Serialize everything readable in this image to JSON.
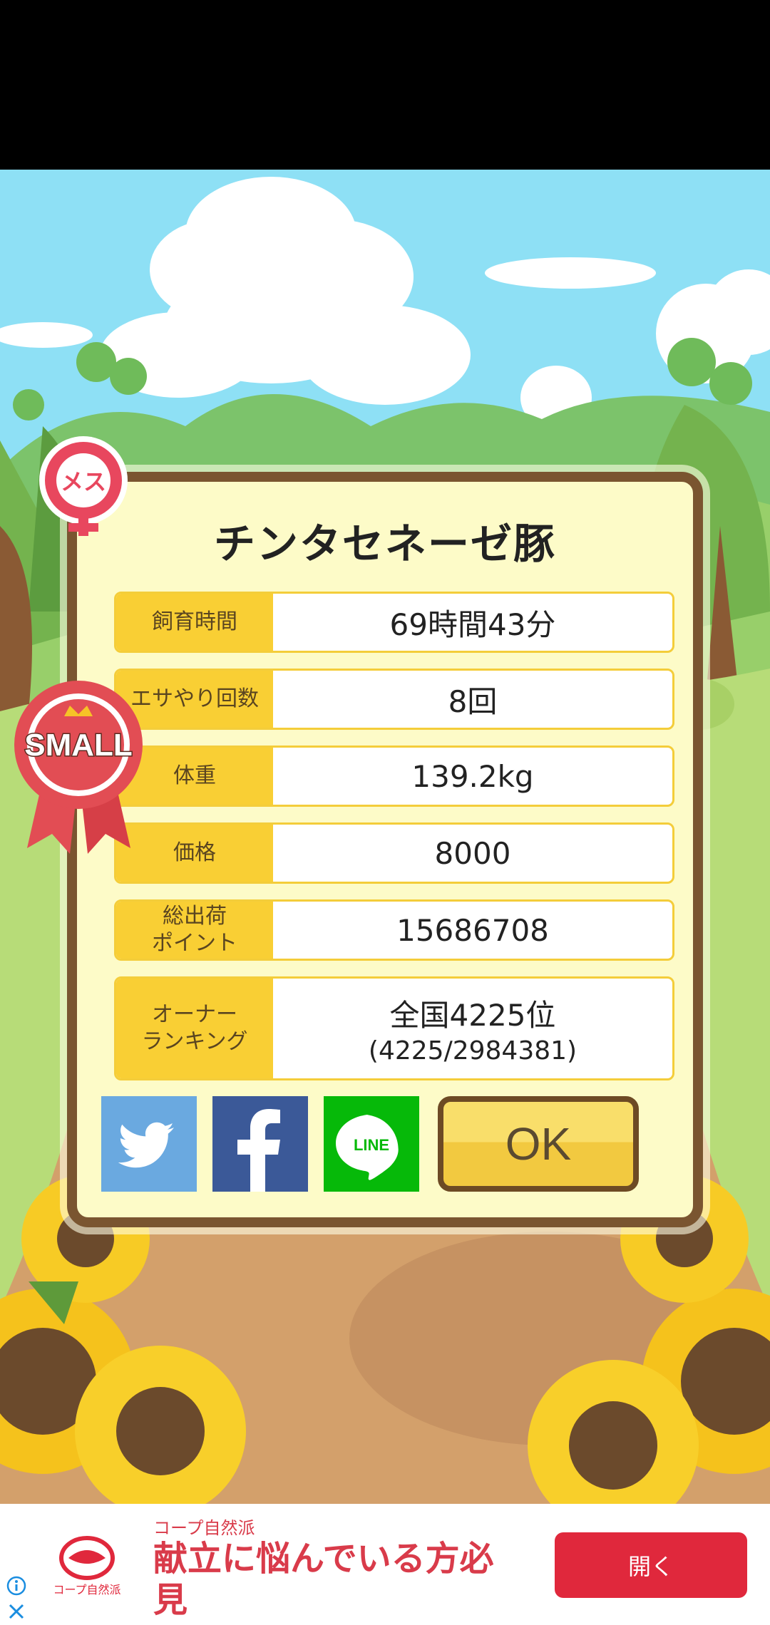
{
  "pig": {
    "name": "チンタセネーゼ豚",
    "gender_badge": "メス",
    "size_ribbon": "SMALL"
  },
  "stats": [
    {
      "label": "飼育時間",
      "value": "69時間43分"
    },
    {
      "label": "エサやり回数",
      "value": "8回"
    },
    {
      "label": "体重",
      "value": "139.2kg"
    },
    {
      "label": "価格",
      "value": "8000"
    },
    {
      "label": "総出荷\nポイント",
      "value": "15686708"
    },
    {
      "label": "オーナー\nランキング",
      "value": "全国4225位",
      "sub_value": "(4225/2984381)"
    }
  ],
  "share": {
    "twitter_icon": "twitter-bird-icon",
    "facebook_icon": "facebook-f-icon",
    "line_label": "LINE"
  },
  "ok_label": "OK",
  "ad": {
    "brand": "コープ自然派",
    "logo_text": "コープ自然派",
    "headline": "献立に悩んでいる方必見",
    "open_label": "開く"
  },
  "colors": {
    "dialog_bg": "#fdfbc8",
    "dialog_border": "#7a5530",
    "label_bg": "#f9cf34",
    "twitter": "#6aa9e0",
    "facebook": "#3b5998",
    "line": "#06b909",
    "ad_accent": "#e0283c"
  }
}
